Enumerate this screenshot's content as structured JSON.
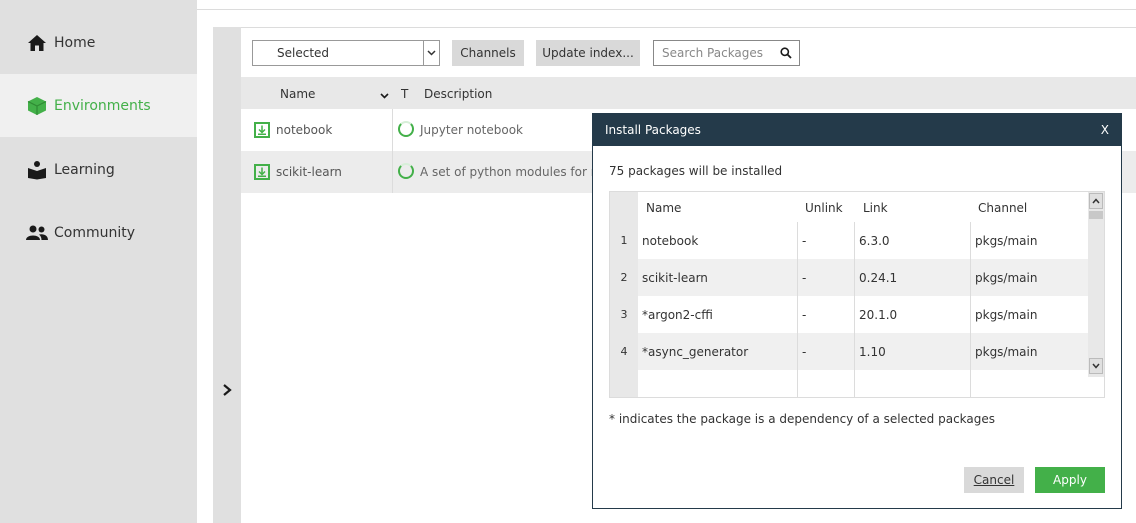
{
  "sidebar": {
    "items": [
      {
        "label": "Home",
        "icon": "home-icon",
        "active": false
      },
      {
        "label": "Environments",
        "icon": "cube-icon",
        "active": true
      },
      {
        "label": "Learning",
        "icon": "book-reader-icon",
        "active": false
      },
      {
        "label": "Community",
        "icon": "people-icon",
        "active": false
      }
    ]
  },
  "toolbar": {
    "filter_value": "Selected",
    "channels_label": "Channels",
    "update_index_label": "Update index...",
    "search_placeholder": "Search Packages"
  },
  "package_table": {
    "columns": {
      "name": "Name",
      "type": "T",
      "description": "Description"
    },
    "rows": [
      {
        "name": "notebook",
        "description": "Jupyter notebook"
      },
      {
        "name": "scikit-learn",
        "description": "A set of python modules for ma"
      }
    ]
  },
  "dialog": {
    "title": "Install Packages",
    "close_label": "X",
    "count_text": "75 packages will be installed",
    "columns": {
      "name": "Name",
      "unlink": "Unlink",
      "link": "Link",
      "channel": "Channel"
    },
    "rows": [
      {
        "index": "1",
        "name": "notebook",
        "unlink": "-",
        "link": "6.3.0",
        "channel": "pkgs/main"
      },
      {
        "index": "2",
        "name": "scikit-learn",
        "unlink": "-",
        "link": "0.24.1",
        "channel": "pkgs/main"
      },
      {
        "index": "3",
        "name": "*argon2-cffi",
        "unlink": "-",
        "link": "20.1.0",
        "channel": "pkgs/main"
      },
      {
        "index": "4",
        "name": "*async_generator",
        "unlink": "-",
        "link": "1.10",
        "channel": "pkgs/main"
      }
    ],
    "note": "* indicates the package is a dependency of a selected packages",
    "cancel_label": "Cancel",
    "apply_label": "Apply"
  },
  "colors": {
    "accent": "#43b049",
    "dialog_header": "#243a4a",
    "sidebar_bg": "#e0e0e0"
  }
}
